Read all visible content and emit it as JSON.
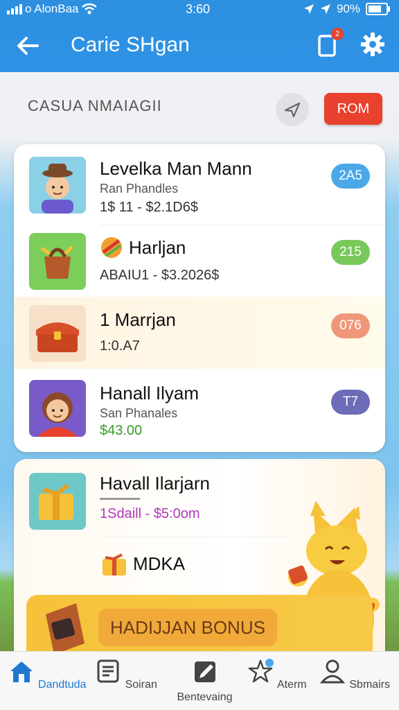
{
  "status": {
    "carrier": "o AlonBaa",
    "time": "3:60",
    "battery": "90%"
  },
  "appbar": {
    "title": "Carie SHgan",
    "notification_count": "2"
  },
  "section": {
    "title": "CASUA NMAIAGII",
    "rom_button": "ROM"
  },
  "list": [
    {
      "title": "Levelka Man Mann",
      "subtitle": "Ran Phandles",
      "price": "1$ 11 - $2.1D6$",
      "badge": "2A5",
      "badge_color": "#4aa8e8"
    },
    {
      "title": "Harljan",
      "subtitle": "",
      "price": "ABAIU1 - $3.2026$",
      "badge": "215",
      "badge_color": "#78c85a"
    },
    {
      "title": "1 Marrjan",
      "subtitle": "",
      "price": "1:0.A7",
      "badge": "076",
      "badge_color": "#f0977a"
    },
    {
      "title": "Hanall Ilyam",
      "subtitle": "San Phanales",
      "price": "$43.00",
      "badge": "T7",
      "badge_color": "#6c6cb8"
    }
  ],
  "feature": {
    "title": "Havall Ilarjarn",
    "price": "1Sdaill - $5:0om",
    "secondary": "MDKA",
    "bonus_label": "HADIJJAN BONUS"
  },
  "bottom_nav": [
    {
      "label": "Dandtuda",
      "icon": "home-icon",
      "active": true
    },
    {
      "label": "Soiran",
      "icon": "list-icon",
      "active": false
    },
    {
      "label": "Bentevaing",
      "icon": "edit-icon",
      "active": false
    },
    {
      "label": "Aterm",
      "icon": "star-icon",
      "active": false
    },
    {
      "label": "Sbmairs",
      "icon": "user-icon",
      "active": false
    }
  ],
  "colors": {
    "primary": "#2d8fe0",
    "accent_red": "#e8412d",
    "nav_active": "#1e78d2"
  }
}
